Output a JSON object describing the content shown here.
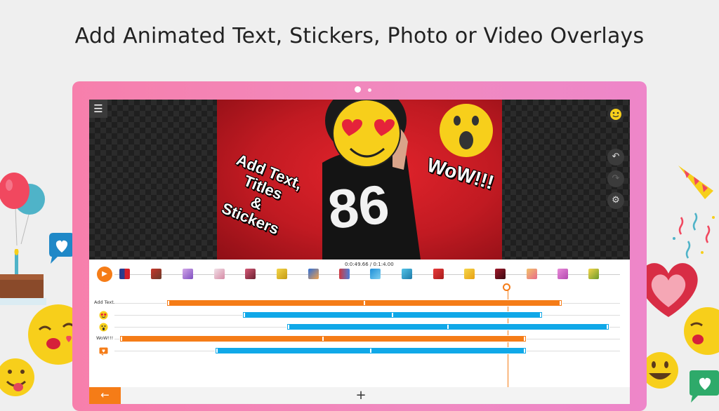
{
  "headline": "Add Animated Text, Stickers, Photo or Video Overlays",
  "preview": {
    "overlay_text_lines": [
      "Add Text,",
      "Titles",
      "&",
      "Stickers"
    ],
    "wow_text": "WoW!!!",
    "jersey_number": "86"
  },
  "toolbar": {
    "menu_icon": "hamburger-icon",
    "sticker_icon": "emoji-icon",
    "undo_icon": "undo-icon",
    "redo_icon": "redo-icon",
    "settings_icon": "gear-icon"
  },
  "timeline": {
    "time_readout": "0:0:49.66 / 0:1:4.00",
    "tracks": [
      {
        "label": "Add Text.",
        "kind": "text"
      },
      {
        "label": "",
        "kind": "heart-eyes-emoji"
      },
      {
        "label": "",
        "kind": "surprised-emoji"
      },
      {
        "label": "WoW!!!",
        "kind": "text"
      },
      {
        "label": "",
        "kind": "image-overlay"
      }
    ]
  },
  "bottom_bar": {
    "back_glyph": "←",
    "add_glyph": "+"
  },
  "colors": {
    "accent_orange": "#f57c17",
    "accent_blue": "#10a8e8",
    "frame_pink": "#f77fac",
    "emoji_yellow": "#f7cf1b"
  }
}
